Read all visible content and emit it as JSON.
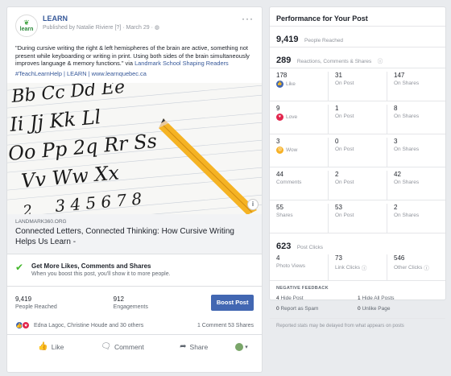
{
  "post": {
    "page_name": "LEARN",
    "avatar_text": "learn",
    "meta": "Published by Natalie Riviere [?] · March 29 ·",
    "more": "···",
    "body": "\"During cursive writing the right & left hemispheres of the brain are active, something not present while keyboarding or writing in print. Using both sides of the brain simultaneously improves language & memory functions.\" via",
    "body_link": "Landmark School Shaping Readers",
    "hashtags": "#TeachLearnHelp | LEARN | www.learnquebec.ca",
    "link_domain": "LANDMARK360.ORG",
    "link_title": "Connected Letters, Connected Thinking: How Cursive Writing Helps Us Learn -",
    "cursive_lines": [
      "Bb Cc Dd Ee",
      "Ii Jj Kk Ll",
      "Oo Pp 2q Rr Ss",
      "Vv Ww Xx",
      "3 4 5 6 7 8",
      "2"
    ],
    "boost": {
      "title": "Get More Likes, Comments and Shares",
      "subtitle": "When you boost this post, you'll show it to more people.",
      "reached_num": "9,419",
      "reached_lbl": "People Reached",
      "eng_num": "912",
      "eng_lbl": "Engagements",
      "button": "Boost Post"
    },
    "reactors": "Edna Lagoc, Christine Houde and 30 others",
    "counts": "1 Comment  53 Shares",
    "actions": {
      "like": "Like",
      "comment": "Comment",
      "share": "Share"
    }
  },
  "perf": {
    "title": "Performance for Your Post",
    "reached_num": "9,419",
    "reached_lbl": "People Reached",
    "reactions_num": "289",
    "reactions_lbl": "Reactions, Comments & Shares",
    "rows": [
      [
        {
          "num": "178",
          "lbl": "Like",
          "emo": "like"
        },
        {
          "num": "31",
          "lbl": "On Post"
        },
        {
          "num": "147",
          "lbl": "On Shares"
        }
      ],
      [
        {
          "num": "9",
          "lbl": "Love",
          "emo": "love"
        },
        {
          "num": "1",
          "lbl": "On Post"
        },
        {
          "num": "8",
          "lbl": "On Shares"
        }
      ],
      [
        {
          "num": "3",
          "lbl": "Wow",
          "emo": "wow"
        },
        {
          "num": "0",
          "lbl": "On Post"
        },
        {
          "num": "3",
          "lbl": "On Shares"
        }
      ],
      [
        {
          "num": "44",
          "lbl": "Comments"
        },
        {
          "num": "2",
          "lbl": "On Post"
        },
        {
          "num": "42",
          "lbl": "On Shares"
        }
      ],
      [
        {
          "num": "55",
          "lbl": "Shares"
        },
        {
          "num": "53",
          "lbl": "On Post"
        },
        {
          "num": "2",
          "lbl": "On Shares"
        }
      ]
    ],
    "clicks_num": "623",
    "clicks_lbl": "Post Clicks",
    "clicks": [
      {
        "num": "4",
        "lbl": "Photo Views"
      },
      {
        "num": "73",
        "lbl": "Link Clicks"
      },
      {
        "num": "546",
        "lbl": "Other Clicks"
      }
    ],
    "neg_title": "NEGATIVE FEEDBACK",
    "neg": [
      [
        {
          "num": "4",
          "lbl": "Hide Post"
        },
        {
          "num": "1",
          "lbl": "Hide All Posts"
        }
      ],
      [
        {
          "num": "0",
          "lbl": "Report as Spam"
        },
        {
          "num": "0",
          "lbl": "Unlike Page"
        }
      ]
    ],
    "footnote": "Reported stats may be delayed from what appears on posts"
  }
}
